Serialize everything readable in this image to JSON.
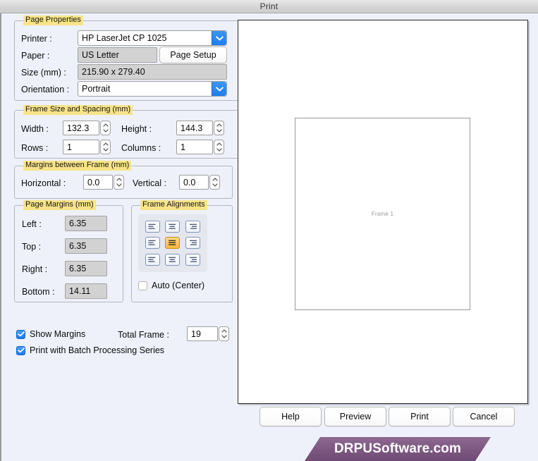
{
  "window": {
    "title": "Print"
  },
  "page_properties": {
    "group_label": "Page Properties",
    "printer_label": "Printer :",
    "printer_value": "HP LaserJet CP 1025",
    "paper_label": "Paper :",
    "paper_value": "US Letter",
    "page_setup_button": "Page Setup",
    "size_label": "Size (mm) :",
    "size_value": "215.90 x 279.40",
    "orientation_label": "Orientation :",
    "orientation_value": "Portrait"
  },
  "frame_size": {
    "group_label": "Frame Size and Spacing (mm)",
    "width_label": "Width :",
    "width_value": "132.3",
    "height_label": "Height :",
    "height_value": "144.3",
    "rows_label": "Rows :",
    "rows_value": "1",
    "columns_label": "Columns :",
    "columns_value": "1"
  },
  "margins_between": {
    "group_label": "Margins between Frame (mm)",
    "horizontal_label": "Horizontal :",
    "horizontal_value": "0.0",
    "vertical_label": "Vertical :",
    "vertical_value": "0.0"
  },
  "page_margins": {
    "group_label": "Page Margins (mm)",
    "left_label": "Left :",
    "left_value": "6.35",
    "top_label": "Top :",
    "top_value": "6.35",
    "right_label": "Right :",
    "right_value": "6.35",
    "bottom_label": "Bottom :",
    "bottom_value": "14.11"
  },
  "frame_alignments": {
    "group_label": "Frame Alignments",
    "selected_index": 4,
    "options": [
      "align-top-left",
      "align-top-center",
      "align-top-right",
      "align-middle-left",
      "align-middle-center",
      "align-middle-right",
      "align-bottom-left",
      "align-bottom-center",
      "align-bottom-right"
    ],
    "auto_center_label": "Auto (Center)",
    "auto_center_checked": false
  },
  "options": {
    "show_margins_label": "Show Margins",
    "show_margins_checked": true,
    "batch_label": "Print with Batch Processing Series",
    "batch_checked": true,
    "total_frame_label": "Total Frame :",
    "total_frame_value": "19"
  },
  "preview": {
    "frame_label": "Frame 1"
  },
  "buttons": {
    "help": "Help",
    "preview": "Preview",
    "print": "Print",
    "cancel": "Cancel"
  },
  "footer": {
    "brand": "DRPUSoftware.com"
  },
  "colors": {
    "accent_blue": "#1f7bf0",
    "group_label_highlight": "#f7e488",
    "selected_align": "#f6b73c",
    "brand_purple": "#7c5780",
    "dialog_bg": "#eef1fa"
  }
}
